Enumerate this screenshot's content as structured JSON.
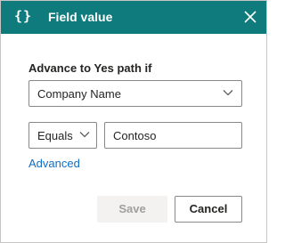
{
  "dialog": {
    "title": "Field value",
    "header_icon": "braces-icon",
    "header_glyph": "{}",
    "close_icon": "close-icon"
  },
  "form": {
    "condition_label": "Advance to Yes path if",
    "field_select_value": "Company Name",
    "operator_select_value": "Equals",
    "value_input_value": "Contoso",
    "advanced_link": "Advanced"
  },
  "actions": {
    "save_label": "Save",
    "save_disabled": true,
    "cancel_label": "Cancel"
  },
  "colors": {
    "header_bg": "#0f7b7c",
    "link": "#0f6fc6"
  }
}
